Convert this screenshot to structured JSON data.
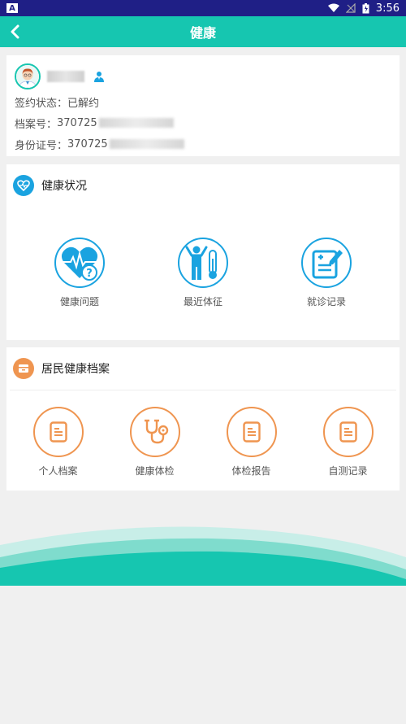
{
  "status_bar": {
    "time": "3:56",
    "app_badge": "A"
  },
  "header": {
    "title": "健康"
  },
  "profile": {
    "sign_status_label": "签约状态：",
    "sign_status_value": "已解约",
    "file_no_label": "档案号：",
    "file_no_value": "370725",
    "id_no_label": "身份证号：",
    "id_no_value": "370725"
  },
  "health_status": {
    "title": "健康状况",
    "items": [
      {
        "label": "健康问题",
        "icon": "heart-question-icon"
      },
      {
        "label": "最近体征",
        "icon": "person-thermometer-icon"
      },
      {
        "label": "就诊记录",
        "icon": "clipboard-edit-icon"
      }
    ]
  },
  "resident_records": {
    "title": "居民健康档案",
    "items": [
      {
        "label": "个人档案",
        "icon": "document-icon"
      },
      {
        "label": "健康体检",
        "icon": "stethoscope-icon"
      },
      {
        "label": "体检报告",
        "icon": "document-icon"
      },
      {
        "label": "自测记录",
        "icon": "document-icon"
      }
    ]
  },
  "colors": {
    "primary": "#16c6b0",
    "blue": "#1aa3e0",
    "orange": "#ef9550",
    "status_bar": "#1f1f86"
  }
}
